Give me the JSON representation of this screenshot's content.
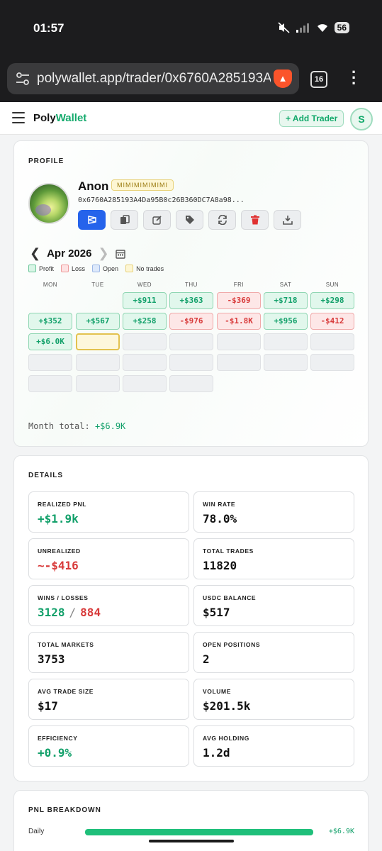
{
  "status": {
    "time": "01:57",
    "battery": "56"
  },
  "browser": {
    "url": "polywallet.app/trader/0x6760A285193A4",
    "tab_count": "16"
  },
  "header": {
    "logo_poly": "Poly",
    "logo_wallet": "Wallet",
    "add_trader": "+ Add Trader",
    "user_initial": "S"
  },
  "profile": {
    "section_title": "PROFILE",
    "name": "Anon",
    "tag": "MIMIMIMIMIMI",
    "address": "0x6760A285193A4Da95B0c26B360DC7A8a98..."
  },
  "calendar": {
    "month": "Apr 2026",
    "legend": [
      "Profit",
      "Loss",
      "Open",
      "No trades"
    ],
    "weekdays": [
      "MON",
      "TUE",
      "WED",
      "THU",
      "FRI",
      "SAT",
      "SUN"
    ],
    "weeks": [
      [
        null,
        null,
        {
          "v": "+$911",
          "s": "profit"
        },
        {
          "v": "+$363",
          "s": "profit"
        },
        {
          "v": "-$369",
          "s": "loss"
        },
        {
          "v": "+$718",
          "s": "profit"
        },
        {
          "v": "+$298",
          "s": "profit"
        }
      ],
      [
        {
          "v": "+$352",
          "s": "profit"
        },
        {
          "v": "+$567",
          "s": "profit"
        },
        {
          "v": "+$258",
          "s": "profit"
        },
        {
          "v": "-$976",
          "s": "loss"
        },
        {
          "v": "-$1.8K",
          "s": "loss"
        },
        {
          "v": "+$956",
          "s": "profit"
        },
        {
          "v": "-$412",
          "s": "loss"
        }
      ],
      [
        {
          "v": "+$6.0K",
          "s": "profit"
        },
        {
          "v": "",
          "s": "today"
        },
        {
          "v": "",
          "s": "empty"
        },
        {
          "v": "",
          "s": "empty"
        },
        {
          "v": "",
          "s": "empty"
        },
        {
          "v": "",
          "s": "empty"
        },
        {
          "v": "",
          "s": "empty"
        }
      ],
      [
        {
          "v": "",
          "s": "empty"
        },
        {
          "v": "",
          "s": "empty"
        },
        {
          "v": "",
          "s": "empty"
        },
        {
          "v": "",
          "s": "empty"
        },
        {
          "v": "",
          "s": "empty"
        },
        {
          "v": "",
          "s": "empty"
        },
        {
          "v": "",
          "s": "empty"
        }
      ],
      [
        {
          "v": "",
          "s": "empty"
        },
        {
          "v": "",
          "s": "empty"
        },
        {
          "v": "",
          "s": "empty"
        },
        {
          "v": "",
          "s": "empty"
        },
        null,
        null,
        null
      ]
    ],
    "month_total_label": "Month total:",
    "month_total_value": "+$6.9K"
  },
  "details": {
    "section_title": "DETAILS",
    "stats": [
      {
        "label": "REALIZED PNL",
        "value": "+$1.9k",
        "tone": "green"
      },
      {
        "label": "WIN RATE",
        "value": "78.0%",
        "tone": ""
      },
      {
        "label": "UNREALIZED",
        "value": "~-$416",
        "tone": "red"
      },
      {
        "label": "TOTAL TRADES",
        "value": "11820",
        "tone": ""
      },
      {
        "label": "WINS / LOSSES",
        "wins": "3128",
        "losses": "884",
        "tone": "split"
      },
      {
        "label": "USDC BALANCE",
        "value": "$517",
        "tone": ""
      },
      {
        "label": "TOTAL MARKETS",
        "value": "3753",
        "tone": ""
      },
      {
        "label": "OPEN POSITIONS",
        "value": "2",
        "tone": ""
      },
      {
        "label": "AVG TRADE SIZE",
        "value": "$17",
        "tone": ""
      },
      {
        "label": "VOLUME",
        "value": "$201.5k",
        "tone": ""
      },
      {
        "label": "EFFICIENCY",
        "value": "+0.9%",
        "tone": "green"
      },
      {
        "label": "AVG HOLDING",
        "value": "1.2d",
        "tone": ""
      }
    ]
  },
  "pnl_breakdown": {
    "section_title": "PNL BREAKDOWN",
    "rows": [
      {
        "label": "Daily",
        "value": "+$6.9K"
      }
    ]
  },
  "colors": {
    "accent_green": "#12a06a",
    "loss_red": "#d83a3a",
    "primary_blue": "#2563eb"
  }
}
